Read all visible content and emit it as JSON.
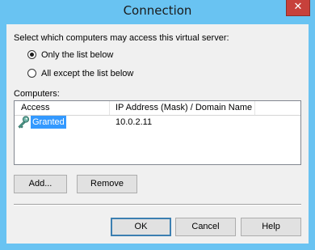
{
  "window": {
    "title": "Connection",
    "close_glyph": "✕"
  },
  "access": {
    "prompt": "Select which computers may access this virtual server:",
    "options": [
      {
        "label": "Only the list below",
        "selected": true
      },
      {
        "label": "All except the list below",
        "selected": false
      }
    ]
  },
  "computers": {
    "label": "Computers:",
    "columns": [
      "Access",
      "IP Address (Mask) / Domain Name"
    ],
    "rows": [
      {
        "access": "Granted",
        "address": "10.0.2.11",
        "icon": "key-icon",
        "selected": true
      }
    ]
  },
  "buttons": {
    "add": "Add...",
    "remove": "Remove",
    "ok": "OK",
    "cancel": "Cancel",
    "help": "Help"
  },
  "colors": {
    "titlebar": "#69c3f2",
    "close": "#c7413b",
    "selection": "#3399ff"
  }
}
